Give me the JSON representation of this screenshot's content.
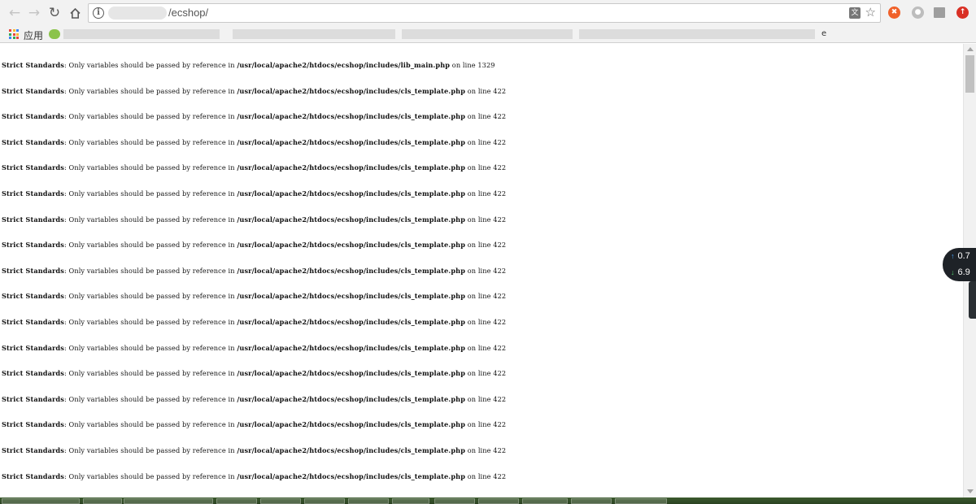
{
  "browser": {
    "address_bar": {
      "url_visible_part": "/ecshop/"
    },
    "bookmarks_bar": {
      "apps_label": "应用",
      "trailing_letter": "e"
    },
    "icons": {
      "back": "back-arrow-icon",
      "forward": "forward-arrow-icon",
      "reload": "reload-icon",
      "home": "home-icon",
      "site_info": "info-icon",
      "translate": "translate-icon",
      "bookmark": "star-icon"
    }
  },
  "page": {
    "warnings": [
      {
        "label": "Strict Standards",
        "message": ": Only variables should be passed by reference in ",
        "file": "/usr/local/apache2/htdocs/ecshop/includes/lib_main.php",
        "on_line": " on line ",
        "line": "1329"
      },
      {
        "label": "Strict Standards",
        "message": ": Only variables should be passed by reference in ",
        "file": "/usr/local/apache2/htdocs/ecshop/includes/cls_template.php",
        "on_line": " on line ",
        "line": "422"
      },
      {
        "label": "Strict Standards",
        "message": ": Only variables should be passed by reference in ",
        "file": "/usr/local/apache2/htdocs/ecshop/includes/cls_template.php",
        "on_line": " on line ",
        "line": "422"
      },
      {
        "label": "Strict Standards",
        "message": ": Only variables should be passed by reference in ",
        "file": "/usr/local/apache2/htdocs/ecshop/includes/cls_template.php",
        "on_line": " on line ",
        "line": "422"
      },
      {
        "label": "Strict Standards",
        "message": ": Only variables should be passed by reference in ",
        "file": "/usr/local/apache2/htdocs/ecshop/includes/cls_template.php",
        "on_line": " on line ",
        "line": "422"
      },
      {
        "label": "Strict Standards",
        "message": ": Only variables should be passed by reference in ",
        "file": "/usr/local/apache2/htdocs/ecshop/includes/cls_template.php",
        "on_line": " on line ",
        "line": "422"
      },
      {
        "label": "Strict Standards",
        "message": ": Only variables should be passed by reference in ",
        "file": "/usr/local/apache2/htdocs/ecshop/includes/cls_template.php",
        "on_line": " on line ",
        "line": "422"
      },
      {
        "label": "Strict Standards",
        "message": ": Only variables should be passed by reference in ",
        "file": "/usr/local/apache2/htdocs/ecshop/includes/cls_template.php",
        "on_line": " on line ",
        "line": "422"
      },
      {
        "label": "Strict Standards",
        "message": ": Only variables should be passed by reference in ",
        "file": "/usr/local/apache2/htdocs/ecshop/includes/cls_template.php",
        "on_line": " on line ",
        "line": "422"
      },
      {
        "label": "Strict Standards",
        "message": ": Only variables should be passed by reference in ",
        "file": "/usr/local/apache2/htdocs/ecshop/includes/cls_template.php",
        "on_line": " on line ",
        "line": "422"
      },
      {
        "label": "Strict Standards",
        "message": ": Only variables should be passed by reference in ",
        "file": "/usr/local/apache2/htdocs/ecshop/includes/cls_template.php",
        "on_line": " on line ",
        "line": "422"
      },
      {
        "label": "Strict Standards",
        "message": ": Only variables should be passed by reference in ",
        "file": "/usr/local/apache2/htdocs/ecshop/includes/cls_template.php",
        "on_line": " on line ",
        "line": "422"
      },
      {
        "label": "Strict Standards",
        "message": ": Only variables should be passed by reference in ",
        "file": "/usr/local/apache2/htdocs/ecshop/includes/cls_template.php",
        "on_line": " on line ",
        "line": "422"
      },
      {
        "label": "Strict Standards",
        "message": ": Only variables should be passed by reference in ",
        "file": "/usr/local/apache2/htdocs/ecshop/includes/cls_template.php",
        "on_line": " on line ",
        "line": "422"
      },
      {
        "label": "Strict Standards",
        "message": ": Only variables should be passed by reference in ",
        "file": "/usr/local/apache2/htdocs/ecshop/includes/cls_template.php",
        "on_line": " on line ",
        "line": "422"
      },
      {
        "label": "Strict Standards",
        "message": ": Only variables should be passed by reference in ",
        "file": "/usr/local/apache2/htdocs/ecshop/includes/cls_template.php",
        "on_line": " on line ",
        "line": "422"
      },
      {
        "label": "Strict Standards",
        "message": ": Only variables should be passed by reference in ",
        "file": "/usr/local/apache2/htdocs/ecshop/includes/cls_template.php",
        "on_line": " on line ",
        "line": "422"
      }
    ]
  },
  "net_widget": {
    "upload_value": "0.7",
    "download_value": "6.9",
    "upload_icon": "up-arrow-icon",
    "download_icon": "down-arrow-icon"
  },
  "colors": {
    "apps_grid": [
      "#e8453c",
      "#f9bb2d",
      "#3b84f4",
      "#34a853",
      "#e8453c",
      "#f9bb2d",
      "#3b84f4",
      "#34a853",
      "#e8453c"
    ],
    "ext_orange": "#f0612a",
    "ext_red": "#d93025",
    "net_up": "#4aa8ff",
    "net_down": "#52d16b"
  }
}
